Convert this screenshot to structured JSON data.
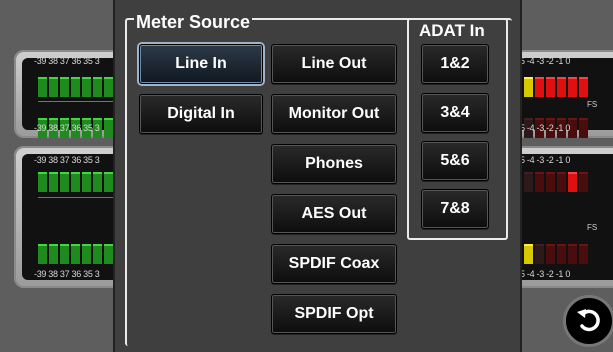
{
  "meters": {
    "scale_left": "-39 38 37 36 35 3",
    "scale_right_top": "5 -4 -3 -2 -1 0",
    "scale_right_mid": "5 -4 -3 -2 -1 0",
    "scale_right_bottom": "5 -4 -3 -2 -1 0",
    "fs_label": "FS"
  },
  "dialog": {
    "title": "Meter Source",
    "buttons": {
      "line_in": "Line In",
      "line_out": "Line Out",
      "digital_in": "Digital In",
      "monitor_out": "Monitor Out",
      "phones": "Phones",
      "aes_out": "AES Out",
      "spdif_coax": "SPDIF Coax",
      "spdif_opt": "SPDIF Opt"
    },
    "selected": "Line In",
    "adat": {
      "title": "ADAT In",
      "buttons": [
        "1&2",
        "3&4",
        "5&6",
        "7&8"
      ]
    }
  },
  "icons": {
    "back": "return-arrow-icon"
  },
  "colors": {
    "meter_green": "#1f8b1f",
    "meter_red": "#e01010",
    "meter_yellow": "#d8c800",
    "dialog_bg": "#3f3f3f",
    "selected_outline": "#9fb4c8"
  }
}
